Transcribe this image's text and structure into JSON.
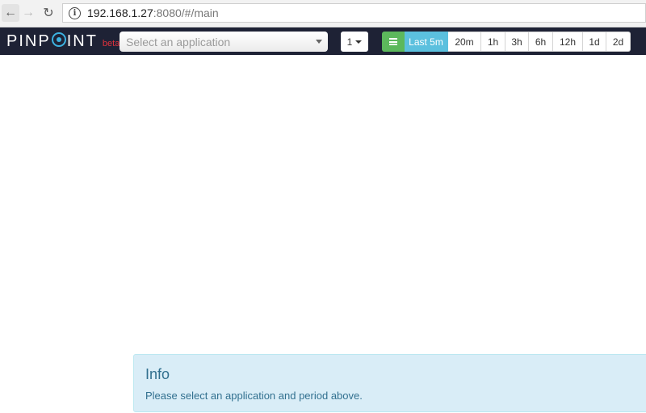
{
  "browser": {
    "url_host": "192.168.1.27",
    "url_rest": ":8080/#/main",
    "back_icon": "arrow-left",
    "forward_icon": "arrow-right",
    "reload_icon": "reload",
    "info_icon": "info-circle"
  },
  "navbar": {
    "logo_text_1": "PINP",
    "logo_text_2": "INT",
    "logo_beta": "beta",
    "app_select_placeholder": "Select an application",
    "count_value": "1",
    "periods": [
      "Last 5m",
      "20m",
      "1h",
      "3h",
      "6h",
      "12h",
      "1d",
      "2d"
    ],
    "active_period": "Last 5m",
    "colors": {
      "navbar_bg": "#1e2235",
      "logo_accent": "#3cb2e0",
      "beta": "#e0323c",
      "list_button": "#5cb85c",
      "active_period": "#5bc0de"
    }
  },
  "info": {
    "title": "Info",
    "message": "Please select an application and period above."
  }
}
